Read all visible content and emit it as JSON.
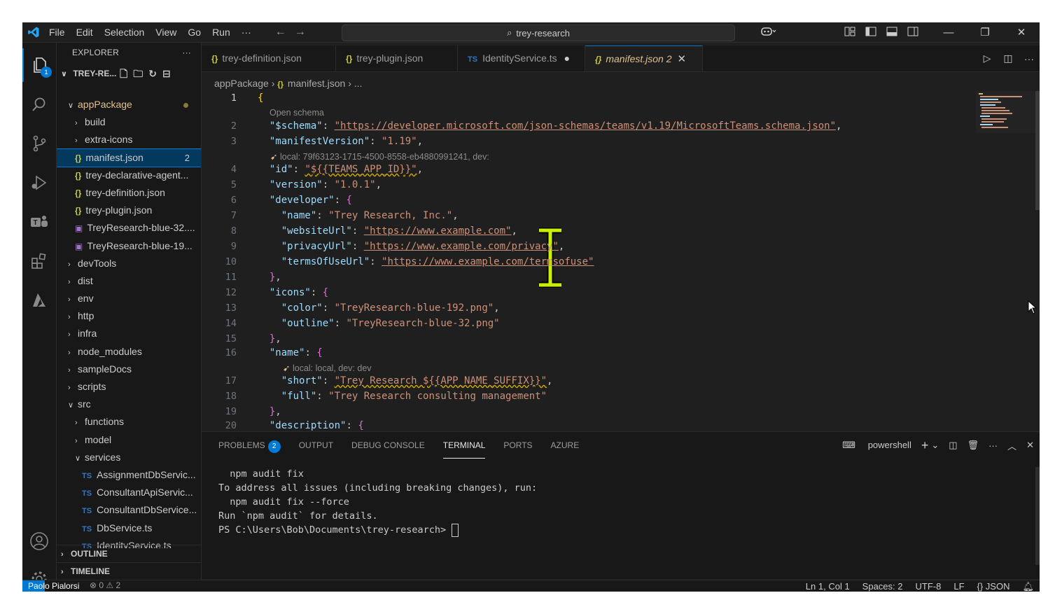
{
  "titlebar": {
    "menu": [
      "File",
      "Edit",
      "Selection",
      "View",
      "Go",
      "Run",
      "···"
    ],
    "search": "trey-research"
  },
  "activity": {
    "explorer_badge": "1",
    "items": [
      "files-icon",
      "search-icon",
      "source-control-icon",
      "run-debug-icon",
      "teams-toolkit-icon",
      "extensions-icon",
      "azure-icon",
      "accounts-icon",
      "settings-gear-icon"
    ]
  },
  "sidebar": {
    "title": "EXPLORER",
    "more": "···",
    "root": "TREY-RE...",
    "tree": [
      {
        "depth": 1,
        "type": "folder",
        "open": true,
        "label": "appPackage",
        "dot": true,
        "color": "#e2c08d"
      },
      {
        "depth": 2,
        "type": "folder",
        "open": false,
        "label": "build"
      },
      {
        "depth": 2,
        "type": "folder",
        "open": false,
        "label": "extra-icons"
      },
      {
        "depth": 2,
        "type": "json",
        "label": "manifest.json",
        "count": "2",
        "selected": true
      },
      {
        "depth": 2,
        "type": "json",
        "label": "trey-declarative-agent..."
      },
      {
        "depth": 2,
        "type": "json",
        "label": "trey-definition.json"
      },
      {
        "depth": 2,
        "type": "json",
        "label": "trey-plugin.json"
      },
      {
        "depth": 2,
        "type": "img",
        "label": "TreyResearch-blue-32...."
      },
      {
        "depth": 2,
        "type": "img",
        "label": "TreyResearch-blue-19..."
      },
      {
        "depth": 1,
        "type": "folder",
        "open": false,
        "label": "devTools"
      },
      {
        "depth": 1,
        "type": "folder",
        "open": false,
        "label": "dist"
      },
      {
        "depth": 1,
        "type": "folder",
        "open": false,
        "label": "env"
      },
      {
        "depth": 1,
        "type": "folder",
        "open": false,
        "label": "http"
      },
      {
        "depth": 1,
        "type": "folder",
        "open": false,
        "label": "infra"
      },
      {
        "depth": 1,
        "type": "folder",
        "open": false,
        "label": "node_modules"
      },
      {
        "depth": 1,
        "type": "folder",
        "open": false,
        "label": "sampleDocs"
      },
      {
        "depth": 1,
        "type": "folder",
        "open": false,
        "label": "scripts"
      },
      {
        "depth": 1,
        "type": "folder",
        "open": true,
        "label": "src"
      },
      {
        "depth": 2,
        "type": "folder",
        "open": false,
        "label": "functions"
      },
      {
        "depth": 2,
        "type": "folder",
        "open": false,
        "label": "model"
      },
      {
        "depth": 2,
        "type": "folder",
        "open": true,
        "label": "services"
      },
      {
        "depth": 3,
        "type": "ts",
        "label": "AssignmentDbServic..."
      },
      {
        "depth": 3,
        "type": "ts",
        "label": "ConsultantApiServic..."
      },
      {
        "depth": 3,
        "type": "ts",
        "label": "ConsultantDbService..."
      },
      {
        "depth": 3,
        "type": "ts",
        "label": "DbService.ts"
      },
      {
        "depth": 3,
        "type": "ts",
        "label": "IdentityService.ts"
      }
    ],
    "outline": "OUTLINE",
    "timeline": "TIMELINE"
  },
  "tabs": [
    {
      "label": "trey-definition.json",
      "icon": "{}"
    },
    {
      "label": "trey-plugin.json",
      "icon": "{}"
    },
    {
      "label": "IdentityService.ts",
      "icon": "TS",
      "modified": true
    },
    {
      "label": "manifest.json 2",
      "icon": "{}",
      "active": true
    }
  ],
  "breadcrumb": {
    "folder": "appPackage",
    "file": "manifest.json",
    "tail": "..."
  },
  "editor": {
    "hint_schema": "Open schema",
    "hint_id": "local: 79f63123-1715-4500-8558-eb4880991241, dev:",
    "hint_name": "local: local, dev: dev",
    "lines": [
      {
        "n": "1",
        "c": "{"
      },
      {
        "n": "2",
        "c": "  \"$schema\": \"https://developer.microsoft.com/json-schemas/teams/v1.19/MicrosoftTeams.schema.json\","
      },
      {
        "n": "3",
        "c": "  \"manifestVersion\": \"1.19\","
      },
      {
        "n": "4",
        "c": "  \"id\": \"${{TEAMS_APP_ID}}\","
      },
      {
        "n": "5",
        "c": "  \"version\": \"1.0.1\","
      },
      {
        "n": "6",
        "c": "  \"developer\": {"
      },
      {
        "n": "7",
        "c": "    \"name\": \"Trey Research, Inc.\","
      },
      {
        "n": "8",
        "c": "    \"websiteUrl\": \"https://www.example.com\","
      },
      {
        "n": "9",
        "c": "    \"privacyUrl\": \"https://www.example.com/privacy\","
      },
      {
        "n": "10",
        "c": "    \"termsOfUseUrl\": \"https://www.example.com/termsofuse\""
      },
      {
        "n": "11",
        "c": "  },"
      },
      {
        "n": "12",
        "c": "  \"icons\": {"
      },
      {
        "n": "13",
        "c": "    \"color\": \"TreyResearch-blue-192.png\","
      },
      {
        "n": "14",
        "c": "    \"outline\": \"TreyResearch-blue-32.png\""
      },
      {
        "n": "15",
        "c": "  },"
      },
      {
        "n": "16",
        "c": "  \"name\": {"
      },
      {
        "n": "17",
        "c": "    \"short\": \"Trey Research ${{APP_NAME_SUFFIX}}\","
      },
      {
        "n": "18",
        "c": "    \"full\": \"Trey Research consulting management\""
      },
      {
        "n": "19",
        "c": "  },"
      },
      {
        "n": "20",
        "c": "  \"description\": {"
      }
    ]
  },
  "panel": {
    "tabs": [
      "PROBLEMS",
      "OUTPUT",
      "DEBUG CONSOLE",
      "TERMINAL",
      "PORTS",
      "AZURE"
    ],
    "problems_count": "2",
    "active": "TERMINAL",
    "shell": "powershell",
    "terminal_lines": [
      "  npm audit fix",
      "",
      "To address all issues (including breaking changes), run:",
      "  npm audit fix --force",
      "",
      "Run `npm audit` for details.",
      "PS C:\\Users\\Bob\\Documents\\trey-research> "
    ]
  },
  "status": {
    "user": "Paolo Pialorsi",
    "left": "⊗ 0 ⚠ 2",
    "position": "Ln 1, Col 1",
    "spaces": "Spaces: 2",
    "encoding": "UTF-8",
    "eol": "LF",
    "language": "{} JSON"
  },
  "colors": {
    "accent": "#0078d4",
    "key": "#9cdcfe",
    "string": "#ce9178",
    "modified": "#e2c08d"
  }
}
